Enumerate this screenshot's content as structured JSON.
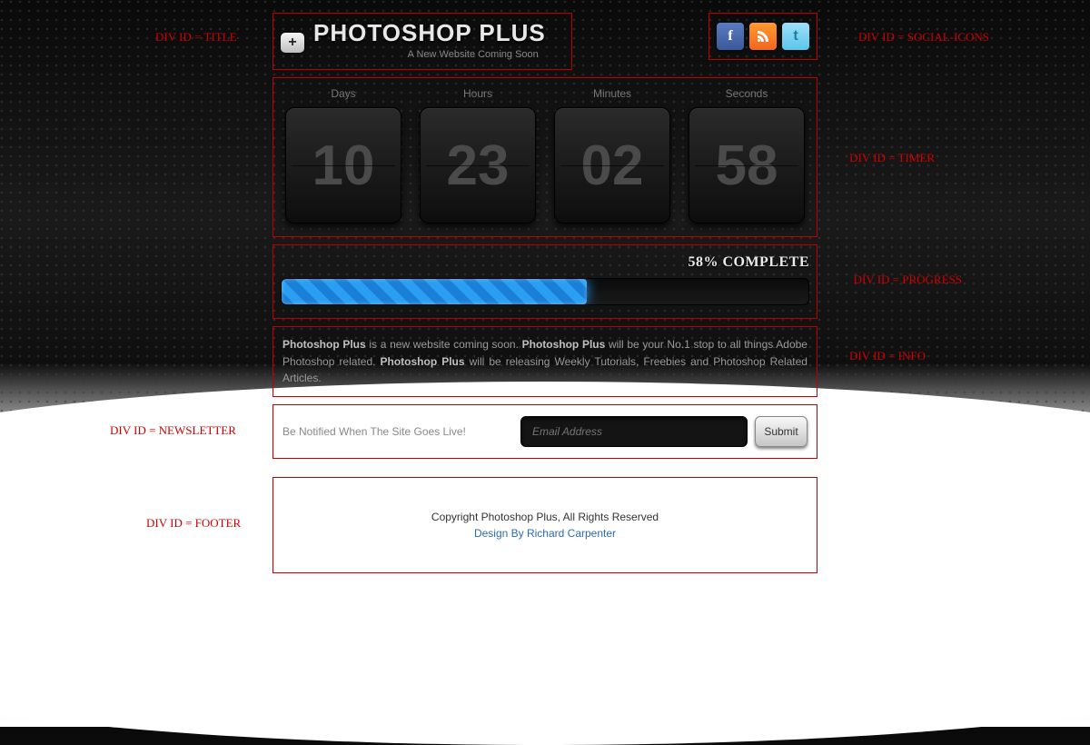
{
  "annotations": {
    "title": "DIV ID = TITLE",
    "social": "DIV ID = SOCIAL-ICONS",
    "timer": "DIV ID = TIMER",
    "progress": "DIV ID = PROGRESS",
    "info": "DIV ID = INFO",
    "newsletter": "DIV ID = NEWSLETTER",
    "footer": "DIV ID = FOOTER"
  },
  "header": {
    "badge_symbol": "+",
    "site_title": "PHOTOSHOP PLUS",
    "tagline": "A New Website Coming Soon"
  },
  "social": {
    "facebook_glyph": "f",
    "rss_glyph": "◷",
    "twitter_glyph": "t"
  },
  "timer": {
    "days_label": "Days",
    "days_value": "10",
    "hours_label": "Hours",
    "hours_value": "23",
    "minutes_label": "Minutes",
    "minutes_value": "02",
    "seconds_label": "Seconds",
    "seconds_value": "58"
  },
  "progress": {
    "percent": 58,
    "label": "58% COMPLETE"
  },
  "info": {
    "b1": "Photoshop Plus",
    "t1": " is a new website coming soon. ",
    "b2": "Photoshop Plus",
    "t2": " will be your No.1 stop to all things Adobe Photoshop related. ",
    "b3": "Photoshop Plus",
    "t3": " will be releasing Weekly Tutorials, Freebies and Photoshop Related Articles."
  },
  "newsletter": {
    "label": "Be Notified When The Site Goes Live!",
    "placeholder": "Email Address",
    "submit_label": "Submit"
  },
  "footer": {
    "copyright": "Copyright Photoshop Plus, All Rights Reserved",
    "design_by": "Design By Richard Carpenter"
  }
}
